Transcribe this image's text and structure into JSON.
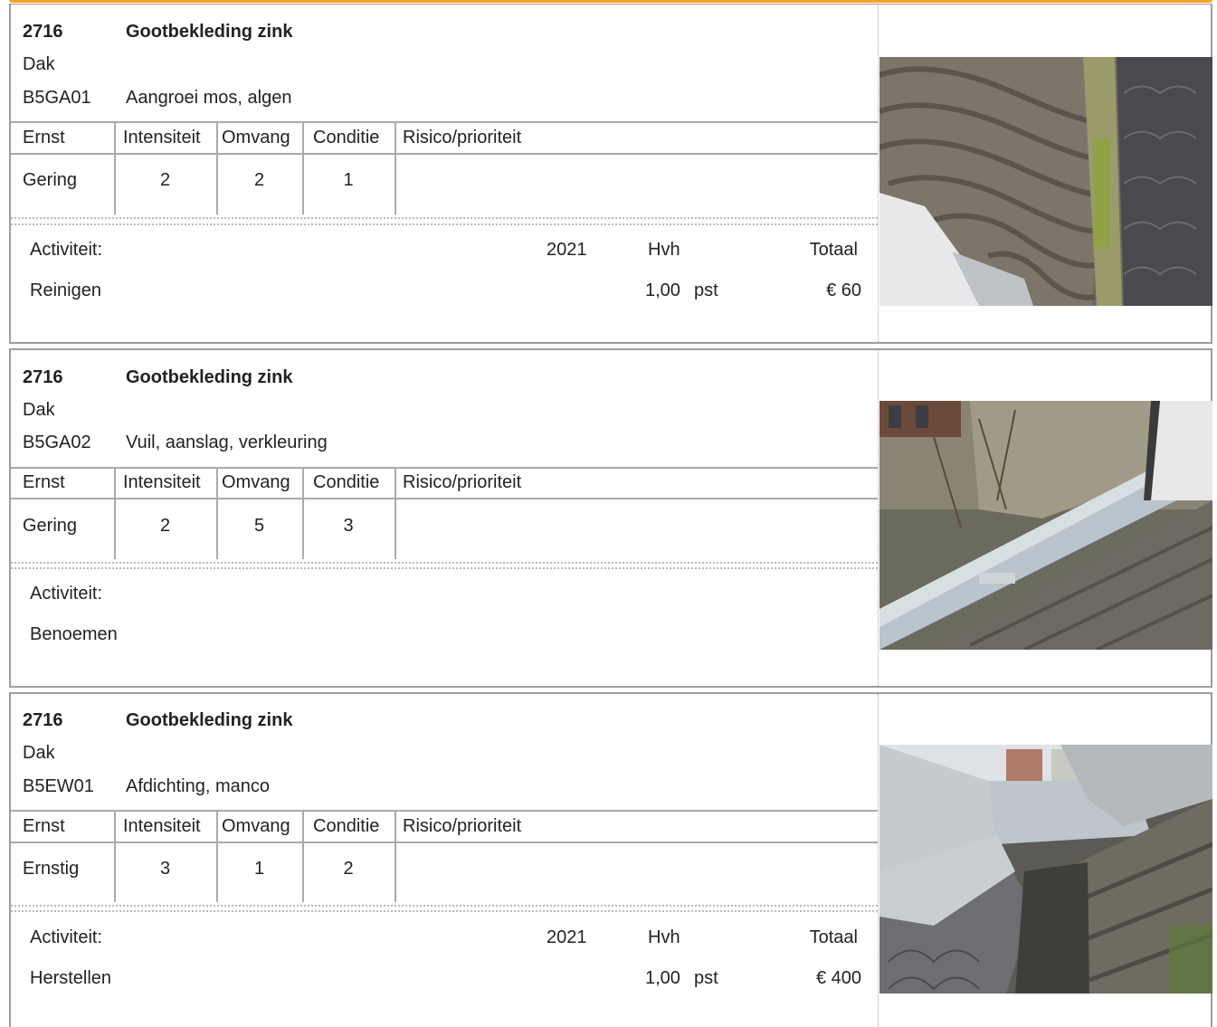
{
  "items": [
    {
      "code": "2716",
      "title": "Gootbekleding zink",
      "location": "Dak",
      "defect_code": "B5GA01",
      "defect_desc": "Aangroei mos, algen",
      "headers": [
        "Ernst",
        "Intensiteit",
        "Omvang",
        "Conditie",
        "Risico/prioriteit"
      ],
      "ernst": "Gering",
      "intensiteit": "2",
      "omvang": "2",
      "conditie": "1",
      "activity_label": "Activiteit:",
      "year": "2021",
      "hvh_label": "Hvh",
      "total_label": "Totaal",
      "activity": "Reinigen",
      "qty": "1,00",
      "unit": "pst",
      "amount": "€ 60",
      "photo_icon": "gutter-moss-photo"
    },
    {
      "code": "2716",
      "title": "Gootbekleding zink",
      "location": "Dak",
      "defect_code": "B5GA02",
      "defect_desc": "Vuil, aanslag, verkleuring",
      "headers": [
        "Ernst",
        "Intensiteit",
        "Omvang",
        "Conditie",
        "Risico/prioriteit"
      ],
      "ernst": "Gering",
      "intensiteit": "2",
      "omvang": "5",
      "conditie": "3",
      "activity_label": "Activiteit:",
      "activity": "Benoemen",
      "photo_icon": "gutter-street-photo"
    },
    {
      "code": "2716",
      "title": "Gootbekleding zink",
      "location": "Dak",
      "defect_code": "B5EW01",
      "defect_desc": "Afdichting, manco",
      "headers": [
        "Ernst",
        "Intensiteit",
        "Omvang",
        "Conditie",
        "Risico/prioriteit"
      ],
      "ernst": "Ernstig",
      "intensiteit": "3",
      "omvang": "1",
      "conditie": "2",
      "activity_label": "Activiteit:",
      "year": "2021",
      "hvh_label": "Hvh",
      "total_label": "Totaal",
      "activity": "Herstellen",
      "qty": "1,00",
      "unit": "pst",
      "amount": "€ 400",
      "photo_icon": "zinc-flashing-photo"
    }
  ]
}
